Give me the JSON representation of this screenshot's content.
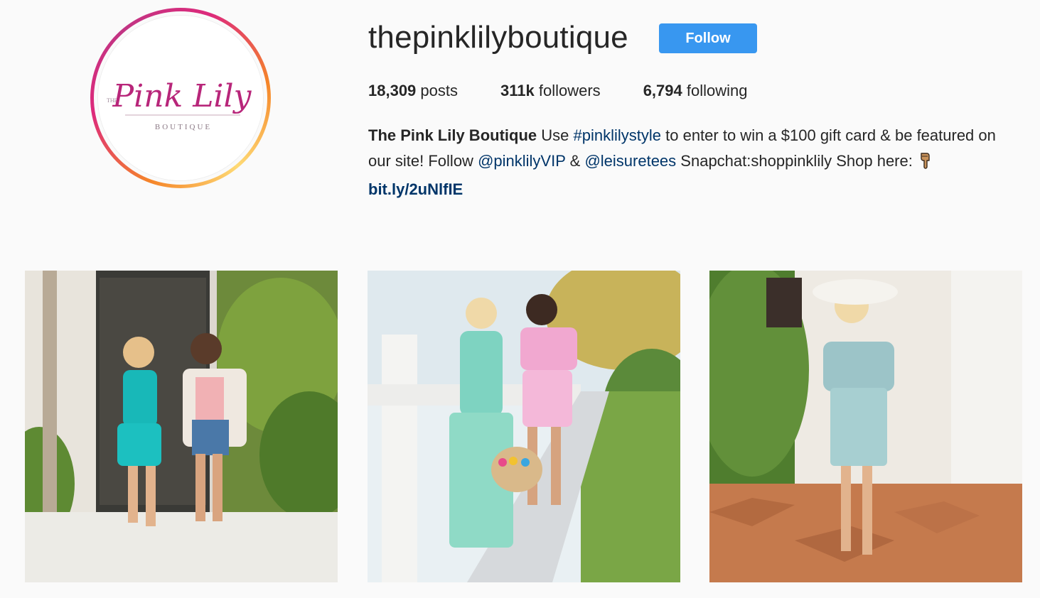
{
  "profile": {
    "username": "thepinklilyboutique",
    "follow_label": "Follow",
    "avatar_logo": {
      "small_text": "THE",
      "main_text": "Pink Lily",
      "sub_text": "BOUTIQUE"
    }
  },
  "stats": {
    "posts_count": "18,309",
    "posts_label": "posts",
    "followers_count": "311k",
    "followers_label": "followers",
    "following_count": "6,794",
    "following_label": "following"
  },
  "bio": {
    "full_name": "The Pink Lily Boutique",
    "text_1": "Use",
    "hashtag": "#pinklilystyle",
    "text_2": "to enter to win a $100 gift card & be featured on our site! Follow",
    "mention_1": "@pinklilyVIP",
    "text_3": "&",
    "mention_2": "@leisuretees",
    "text_4": "Snapchat:shoppinklily Shop here:",
    "emoji_icon": "pointing-down-icon",
    "link": "bit.ly/2uNlfIE"
  },
  "posts": [
    {
      "icon": "post-photo-icon"
    },
    {
      "icon": "post-photo-icon"
    },
    {
      "icon": "post-photo-icon"
    }
  ],
  "colors": {
    "follow_button": "#3897f0",
    "link": "#003569",
    "brand_pink": "#c0287a",
    "background": "#fafafa"
  }
}
